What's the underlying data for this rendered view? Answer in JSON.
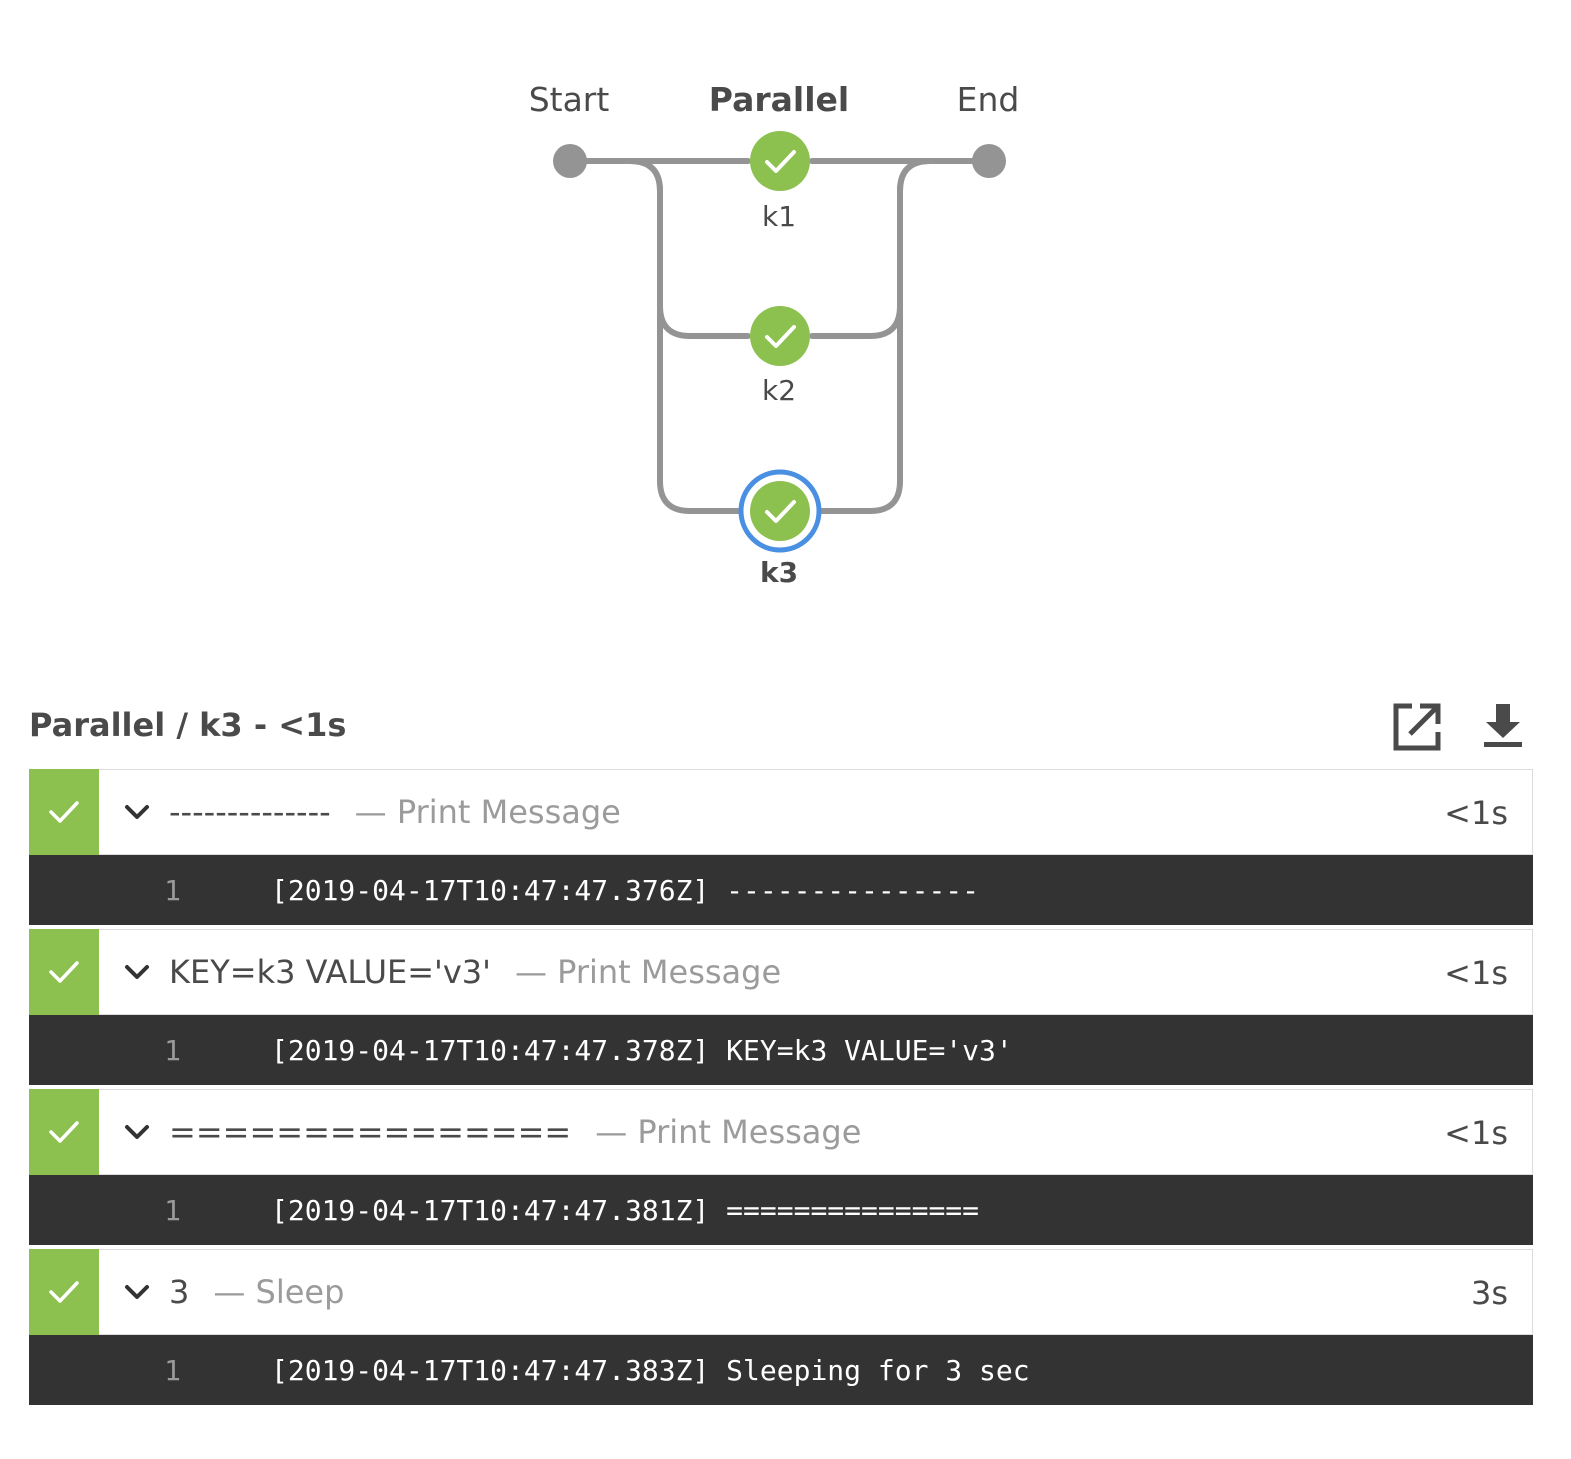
{
  "graph": {
    "labels": {
      "start": "Start",
      "parallel": "Parallel",
      "end": "End"
    },
    "stages": [
      {
        "label": "k1",
        "status": "success",
        "selected": false
      },
      {
        "label": "k2",
        "status": "success",
        "selected": false
      },
      {
        "label": "k3",
        "status": "success",
        "selected": true
      }
    ]
  },
  "step_header": {
    "title": "Parallel / k3 - <1s",
    "icons": [
      "open-external-icon",
      "download-icon"
    ]
  },
  "steps": [
    {
      "name": "--------------",
      "description": "— Print Message",
      "duration": "<1s",
      "log": {
        "line": "1",
        "text": "[2019-04-17T10:47:47.376Z] ---------------"
      }
    },
    {
      "name": "KEY=k3 VALUE='v3'",
      "description": "— Print Message",
      "duration": "<1s",
      "log": {
        "line": "1",
        "text": "[2019-04-17T10:47:47.378Z] KEY=k3 VALUE='v3'"
      }
    },
    {
      "name": "===============",
      "description": "— Print Message",
      "duration": "<1s",
      "log": {
        "line": "1",
        "text": "[2019-04-17T10:47:47.381Z] ==============="
      }
    },
    {
      "name": "3",
      "description": "— Sleep",
      "duration": "3s",
      "log": {
        "line": "1",
        "text": "[2019-04-17T10:47:47.383Z] Sleeping for 3 sec"
      }
    }
  ],
  "colors": {
    "success": "#8cc04f",
    "selected_ring": "#4a90e2",
    "connector": "#949494",
    "log_bg": "#333333"
  }
}
